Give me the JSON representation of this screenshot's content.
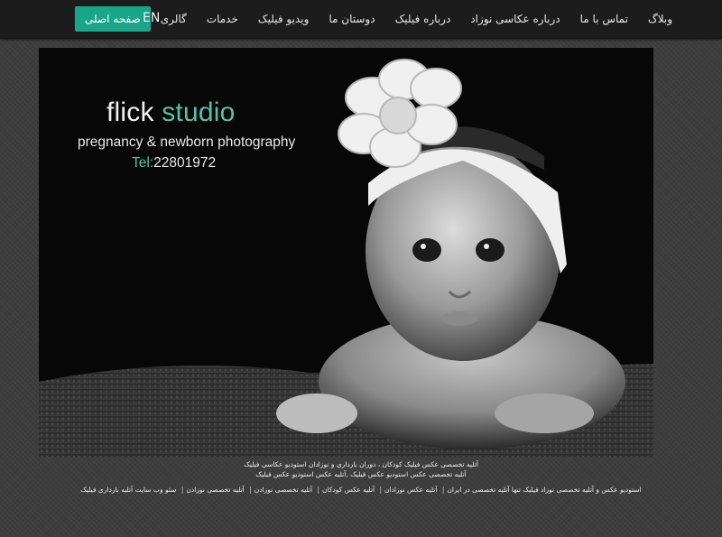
{
  "nav": {
    "items": [
      {
        "label": "صفحه اصلی",
        "active": true
      },
      {
        "label": "گالری"
      },
      {
        "label": "خدمات"
      },
      {
        "label": "ویدیو فیلیک"
      },
      {
        "label": "دوستان ما"
      },
      {
        "label": "درباره فیلیک"
      },
      {
        "label": "درباره عکاسی نوزاد"
      },
      {
        "label": "تماس با ما"
      },
      {
        "label": "وبلاگ"
      }
    ],
    "lang": "EN"
  },
  "hero": {
    "brand_main": "flick",
    "brand_accent": "studio",
    "tagline": "pregnancy & newborn photography",
    "tel_label": "Tel:",
    "tel_number": "22801972"
  },
  "footer": {
    "line1": "آتلیه تخصصی عکس فیلیک کودکان ، دوران بارداری و نوزادان استودیو عکاسی فیلیک",
    "line2": "آتلیه تخصصی عکس استودیو عکس فیلیک ,آتلیه عکس استودیو عکس فیلیک",
    "links": [
      "استودیو عکس و آتلیه تخصصی نوزاد فیلیک تنها آتلیه تخصصی در ایران",
      "آتلیه عکس نوزادان",
      "آتلیه عکس کودکان",
      "آتلیه تخصصی نوزادن",
      "آتلیه تخصصی نوزادن",
      "سئو وب سایت آتلیه بارداری فیلیک"
    ]
  },
  "colors": {
    "accent": "#54c2a6",
    "active_nav": "#19a58a",
    "navbar": "#1c1c1c",
    "background": "#3d3d3d"
  }
}
